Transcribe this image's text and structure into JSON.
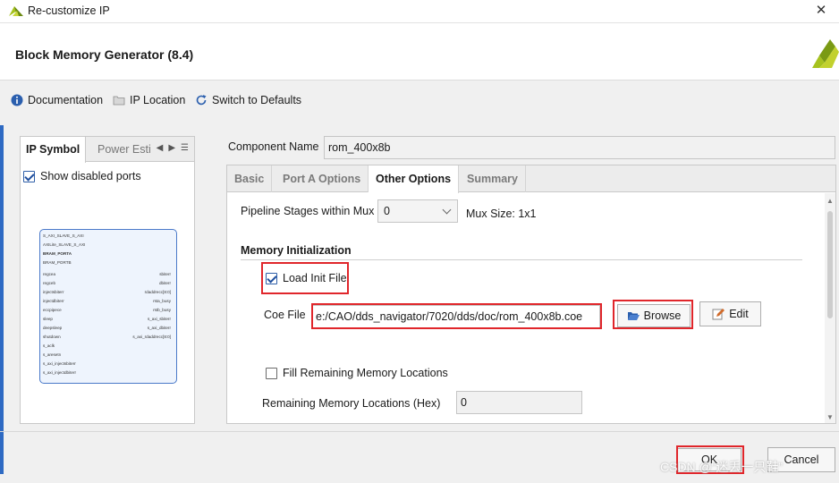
{
  "window": {
    "title": "Re-customize IP",
    "close_symbol": "✕"
  },
  "header": {
    "title": "Block Memory Generator (8.4)"
  },
  "toolbar": {
    "documentation": "Documentation",
    "ip_location": "IP Location",
    "switch_defaults": "Switch to Defaults"
  },
  "left_panel": {
    "tabs": [
      "IP Symbol",
      "Power Esti"
    ],
    "show_disabled_ports": {
      "label": "Show disabled ports",
      "checked": true
    },
    "symbol": {
      "interfaces": [
        "S_AXI_SLAVE_S_AXI",
        "AXILite_SLAVE_S_AXI",
        "BRAM_PORTA",
        "BRAM_PORTB"
      ],
      "left_ports": [
        "regcea",
        "regceb",
        "injectsbiterr",
        "injectdbiterr",
        "eccpipece",
        "sleep",
        "deepsleep",
        "shutdown",
        "s_aclk",
        "s_aresetn",
        "s_axi_injectsbiterr",
        "s_axi_injectdbiterr"
      ],
      "right_ports": [
        "sbiterr",
        "dbiterr",
        "rdaddrecc[8:0]",
        "rsta_busy",
        "rstb_busy",
        "s_axi_sbiterr",
        "s_axi_dbiterr",
        "s_axi_rdaddrecc[8:0]"
      ]
    }
  },
  "component": {
    "label": "Component Name",
    "value": "rom_400x8b"
  },
  "tabs": [
    "Basic",
    "Port A Options",
    "Other Options",
    "Summary"
  ],
  "active_tab": "Other Options",
  "pipeline": {
    "label": "Pipeline Stages within Mux",
    "value": "0",
    "mux_size": "Mux Size: 1x1"
  },
  "memory_init": {
    "section_title": "Memory Initialization",
    "load_init": {
      "label": "Load Init File",
      "checked": true
    },
    "coe_label": "Coe File",
    "coe_value": "e:/CAO/dds_navigator/7020/dds/doc/rom_400x8b.coe",
    "browse": "Browse",
    "edit": "Edit",
    "fill_remaining": {
      "label": "Fill Remaining Memory Locations",
      "checked": false
    },
    "remaining_label": "Remaining Memory Locations (Hex)",
    "remaining_value": "0"
  },
  "footer": {
    "ok": "OK",
    "cancel": "Cancel"
  },
  "watermark": "CSDN @“迷丢一只鞋”",
  "colors": {
    "highlight": "#e0262b",
    "accent": "#2e6ac3",
    "brand": "#8fb21c"
  }
}
